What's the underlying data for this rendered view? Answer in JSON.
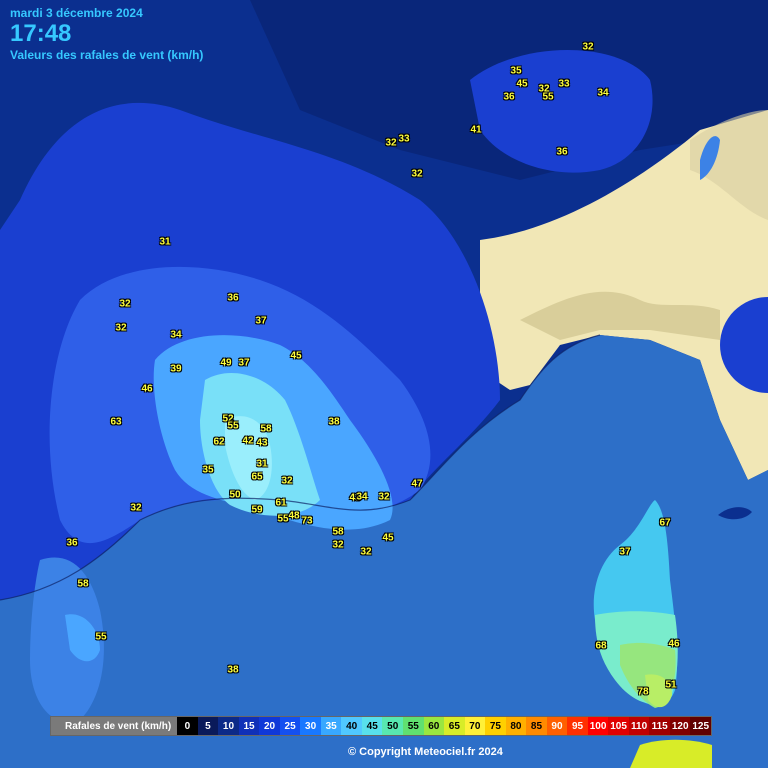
{
  "header": {
    "date": "mardi 3 décembre 2024",
    "time": "17:48",
    "subtitle": "Valeurs des rafales de vent (km/h)"
  },
  "map": {
    "colors": {
      "sea": "#2d6fc8",
      "land_far": "#0b2f8f",
      "band_31": "#1a3fd0",
      "band_36": "#2f5fe8",
      "band_45": "#4aa6ff",
      "band_55": "#79e0f8",
      "italy": "#f1e7b6",
      "corsica_band_45": "#45c8f0",
      "corsica_band_55": "#79eccc",
      "corsica_band_65": "#96e67e",
      "corsica_band_70": "#b8ee66"
    }
  },
  "observations": [
    {
      "value": "32"
    },
    {
      "value": "35"
    },
    {
      "value": "45"
    },
    {
      "value": "32"
    },
    {
      "value": "33"
    },
    {
      "value": "36"
    },
    {
      "value": "55"
    },
    {
      "value": "34"
    },
    {
      "value": "32"
    },
    {
      "value": "33"
    },
    {
      "value": "41"
    },
    {
      "value": "36"
    },
    {
      "value": "32"
    },
    {
      "value": "31"
    },
    {
      "value": "32"
    },
    {
      "value": "36"
    },
    {
      "value": "32"
    },
    {
      "value": "37"
    },
    {
      "value": "34"
    },
    {
      "value": "45"
    },
    {
      "value": "49"
    },
    {
      "value": "37"
    },
    {
      "value": "39"
    },
    {
      "value": "46"
    },
    {
      "value": "63"
    },
    {
      "value": "38"
    },
    {
      "value": "52"
    },
    {
      "value": "55"
    },
    {
      "value": "58"
    },
    {
      "value": "62"
    },
    {
      "value": "42"
    },
    {
      "value": "43"
    },
    {
      "value": "31"
    },
    {
      "value": "35"
    },
    {
      "value": "65"
    },
    {
      "value": "32"
    },
    {
      "value": "50"
    },
    {
      "value": "61"
    },
    {
      "value": "59"
    },
    {
      "value": "55"
    },
    {
      "value": "48"
    },
    {
      "value": "73"
    },
    {
      "value": "43"
    },
    {
      "value": "34"
    },
    {
      "value": "32"
    },
    {
      "value": "47"
    },
    {
      "value": "58"
    },
    {
      "value": "32"
    },
    {
      "value": "45"
    },
    {
      "value": "32"
    },
    {
      "value": "32"
    },
    {
      "value": "36"
    },
    {
      "value": "58"
    },
    {
      "value": "55"
    },
    {
      "value": "38"
    },
    {
      "value": "67"
    },
    {
      "value": "37"
    },
    {
      "value": "46"
    },
    {
      "value": "68"
    },
    {
      "value": "51"
    },
    {
      "value": "78"
    }
  ],
  "legend": {
    "title": "Rafales de vent (km/h)",
    "items": [
      {
        "label": "0",
        "color": "#000000"
      },
      {
        "label": "5",
        "color": "#0a1a5a"
      },
      {
        "label": "10",
        "color": "#0c2a88"
      },
      {
        "label": "15",
        "color": "#1030b8"
      },
      {
        "label": "20",
        "color": "#1038d8"
      },
      {
        "label": "25",
        "color": "#1450f0"
      },
      {
        "label": "30",
        "color": "#1878ff"
      },
      {
        "label": "35",
        "color": "#38a8ff"
      },
      {
        "label": "40",
        "color": "#50c8ff"
      },
      {
        "label": "45",
        "color": "#58e0ec"
      },
      {
        "label": "50",
        "color": "#58e8b0"
      },
      {
        "label": "55",
        "color": "#60e070"
      },
      {
        "label": "60",
        "color": "#9ae640"
      },
      {
        "label": "65",
        "color": "#d8ec28"
      },
      {
        "label": "70",
        "color": "#fff038"
      },
      {
        "label": "75",
        "color": "#ffd000"
      },
      {
        "label": "80",
        "color": "#ffb000"
      },
      {
        "label": "85",
        "color": "#ff8a00"
      },
      {
        "label": "90",
        "color": "#ff6000"
      },
      {
        "label": "95",
        "color": "#ff3000"
      },
      {
        "label": "100",
        "color": "#ff0000"
      },
      {
        "label": "105",
        "color": "#e00000"
      },
      {
        "label": "110",
        "color": "#c00000"
      },
      {
        "label": "115",
        "color": "#a00000"
      },
      {
        "label": "120",
        "color": "#800000"
      },
      {
        "label": "125",
        "color": "#600000"
      }
    ]
  },
  "copyright": "© Copyright Meteociel.fr 2024"
}
